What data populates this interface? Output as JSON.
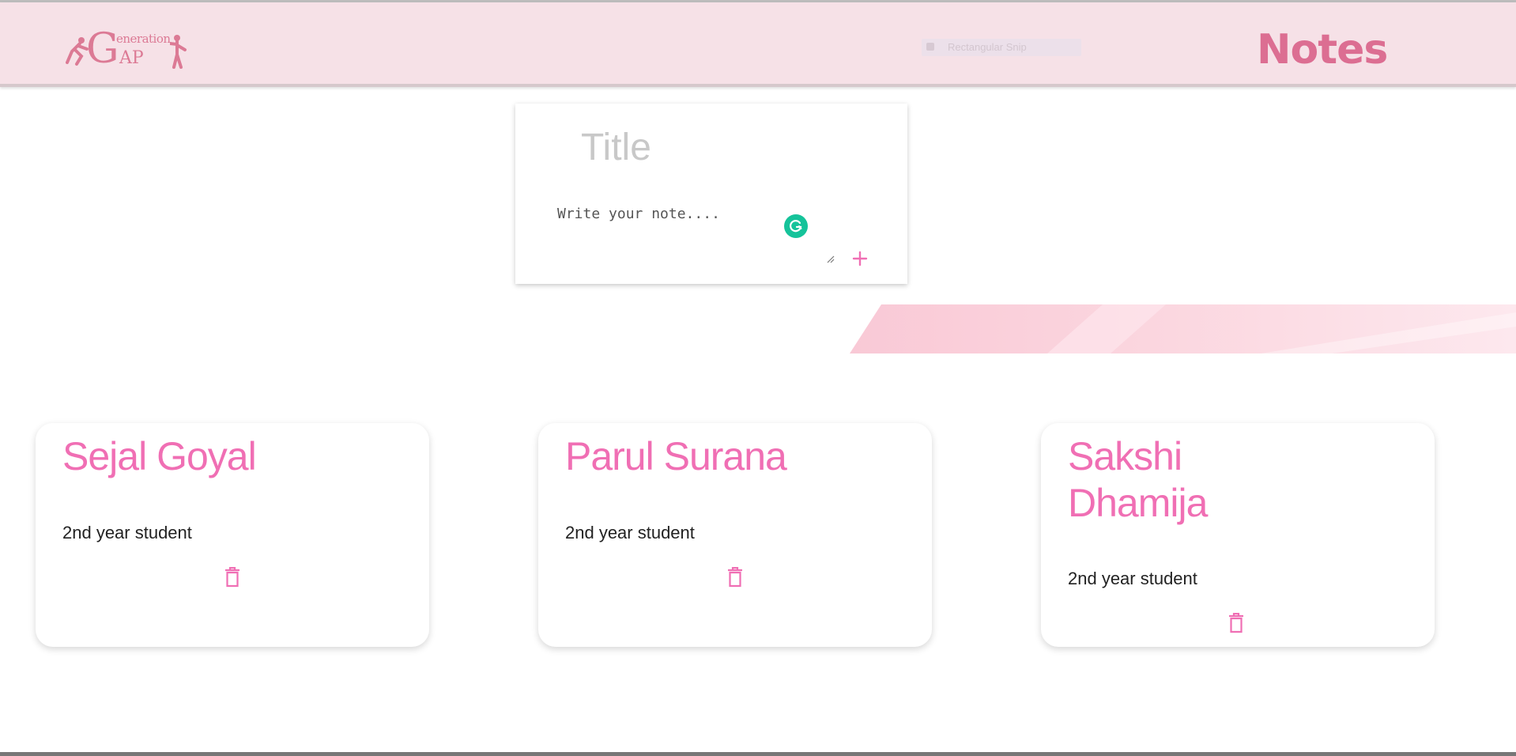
{
  "header": {
    "logo_top": "eneration",
    "logo_big": "G",
    "logo_bottom": "AP",
    "snip_label": "Rectangular Snip",
    "app_title": "Notes"
  },
  "form": {
    "title_placeholder": "Title",
    "note_placeholder": "Write your note....",
    "add_icon": "plus-icon"
  },
  "notes": [
    {
      "title": "Sejal Goyal",
      "body": "2nd year student"
    },
    {
      "title": "Parul Surana",
      "body": "2nd year student"
    },
    {
      "title": "Sakshi Dhamija",
      "body": "2nd year student"
    }
  ],
  "colors": {
    "accent": "#f06fb4",
    "header_bg": "#f6e1e7",
    "title_color": "#dc6e92",
    "grammarly": "#15c39a"
  }
}
